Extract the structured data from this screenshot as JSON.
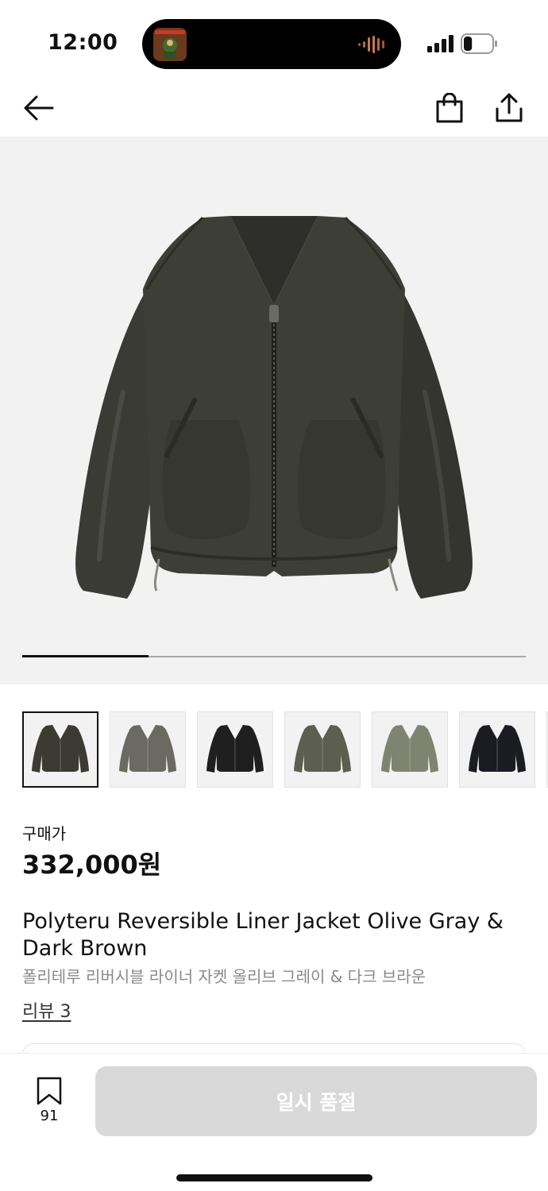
{
  "status_bar": {
    "time": "12:00",
    "battery_level": 0.3
  },
  "nav": {
    "back_icon": "arrow-left-icon",
    "cart_icon": "shopping-bag-icon",
    "share_icon": "share-icon"
  },
  "gallery": {
    "image": "olive-jacket-front",
    "progress": 0.25,
    "thumbnails": [
      {
        "color": "#3b3a33",
        "selected": true
      },
      {
        "color": "#6a6a62",
        "selected": false
      },
      {
        "color": "#1f1f1f",
        "selected": false
      },
      {
        "color": "#5c5e50",
        "selected": false
      },
      {
        "color": "#7e8470",
        "selected": false
      },
      {
        "color": "#1b1c22",
        "selected": false
      }
    ]
  },
  "product": {
    "price_label": "구매가",
    "price": "332,000원",
    "title_en": "Polyteru Reversible Liner Jacket Olive Gray & Dark Brown",
    "title_ko": "폴리테루 리버시블 라이너 자켓 올리브 그레이 & 다크 브라운",
    "review_link": "리뷰 3"
  },
  "bottom_bar": {
    "wishlist_count": "91",
    "soldout_label": "일시 품절"
  },
  "colors": {
    "accent": "#111111",
    "disabled_button": "#d9d9d9",
    "hero_bg": "#f2f2f2"
  }
}
